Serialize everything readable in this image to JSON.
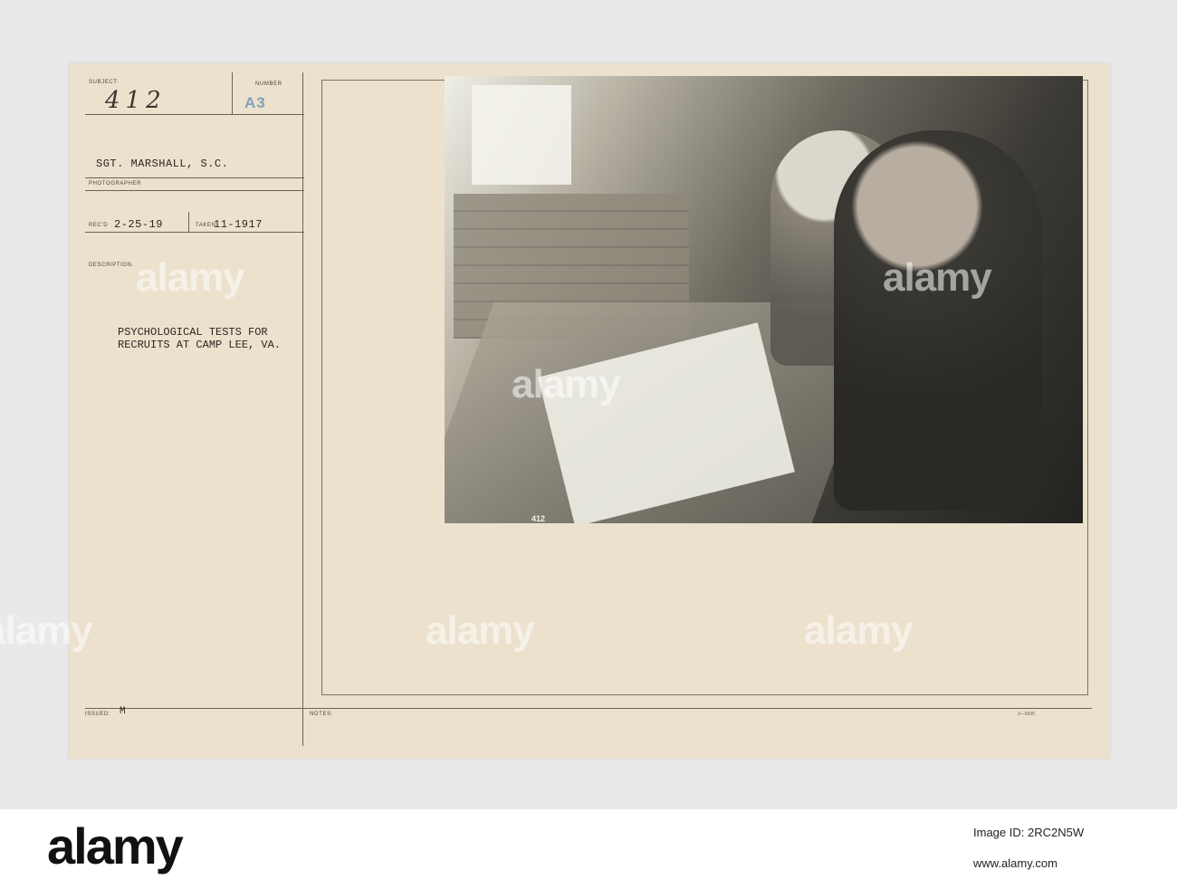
{
  "card": {
    "subject_label": "SUBJECT:",
    "subject_value": "412",
    "number_label": "NUMBER",
    "number_value": "A3",
    "photographer_value": "SGT. MARSHALL, S.C.",
    "photographer_label": "PHOTOGRAPHER",
    "recd_label": "REC'D",
    "recd_value": "2-25-19",
    "taken_label": "TAKEN",
    "taken_value": "11-1917",
    "description_label": "DESCRIPTION.",
    "description_text": "PSYCHOLOGICAL TESTS FOR\nRECRUITS AT CAMP LEE, VA.",
    "issued_label": "ISSUED:",
    "issued_value": "M",
    "notes_label": "NOTES:",
    "form_number": "3—5605",
    "photo_caption": "412"
  },
  "watermark": "alamy",
  "footer": {
    "logo": "alamy",
    "image_id": "Image ID: 2RC2N5W",
    "url": "www.alamy.com"
  }
}
